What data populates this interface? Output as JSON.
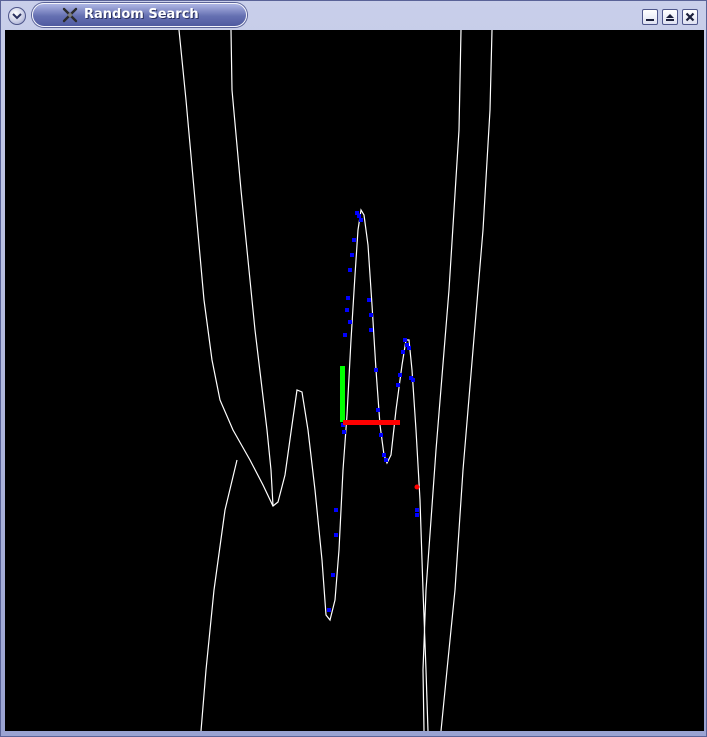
{
  "window": {
    "title": "Random Search",
    "menu_icon": "chevron-down-icon",
    "app_icon": "wrench-icon",
    "controls": [
      "minimize-icon",
      "maximize-icon",
      "close-icon"
    ]
  },
  "plot": {
    "background": "#000000",
    "curve_color": "#ffffff",
    "sample_color": "#0000ff",
    "best_point_color": "#ff0000",
    "axis_x_color": "#ff0000",
    "axis_y_color": "#00ff00"
  }
}
